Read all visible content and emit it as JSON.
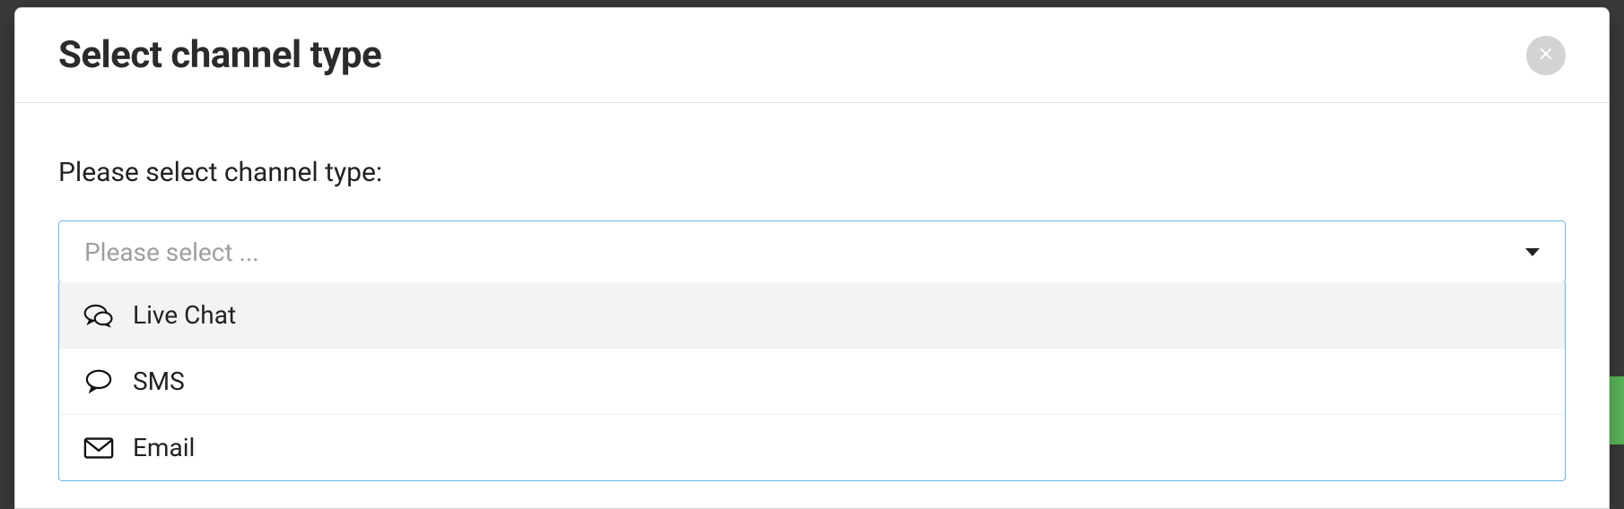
{
  "modal": {
    "title": "Select channel type",
    "prompt": "Please select channel type:",
    "select": {
      "placeholder": "Please select ...",
      "options": [
        {
          "icon": "chats-icon",
          "label": "Live Chat",
          "highlight": true
        },
        {
          "icon": "comment-icon",
          "label": "SMS",
          "highlight": false
        },
        {
          "icon": "envelope-icon",
          "label": "Email",
          "highlight": false
        }
      ]
    }
  }
}
